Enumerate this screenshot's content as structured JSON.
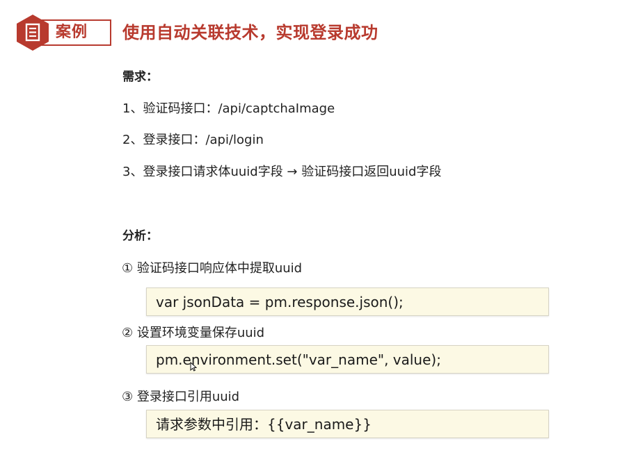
{
  "header": {
    "tag_label": "案例",
    "title": "使用自动关联技术，实现登录成功",
    "accent_color": "#b83a2e",
    "badge_icon": "document-icon"
  },
  "requirements": {
    "heading": "需求：",
    "items": [
      "1、验证码接口：/api/captchaImage",
      "2、登录接口：/api/login",
      "3、登录接口请求体uuid字段 → 验证码接口返回uuid字段"
    ]
  },
  "analysis": {
    "heading": "分析：",
    "steps": [
      {
        "label": "① 验证码接口响应体中提取uuid",
        "code": "var jsonData = pm.response.json();"
      },
      {
        "label": "② 设置环境变量保存uuid",
        "code": "pm.environment.set(\"var_name\", value);"
      },
      {
        "label": "③ 登录接口引用uuid",
        "code": "请求参数中引用：{{var_name}}"
      }
    ],
    "code_background": "#fcf9e4"
  }
}
